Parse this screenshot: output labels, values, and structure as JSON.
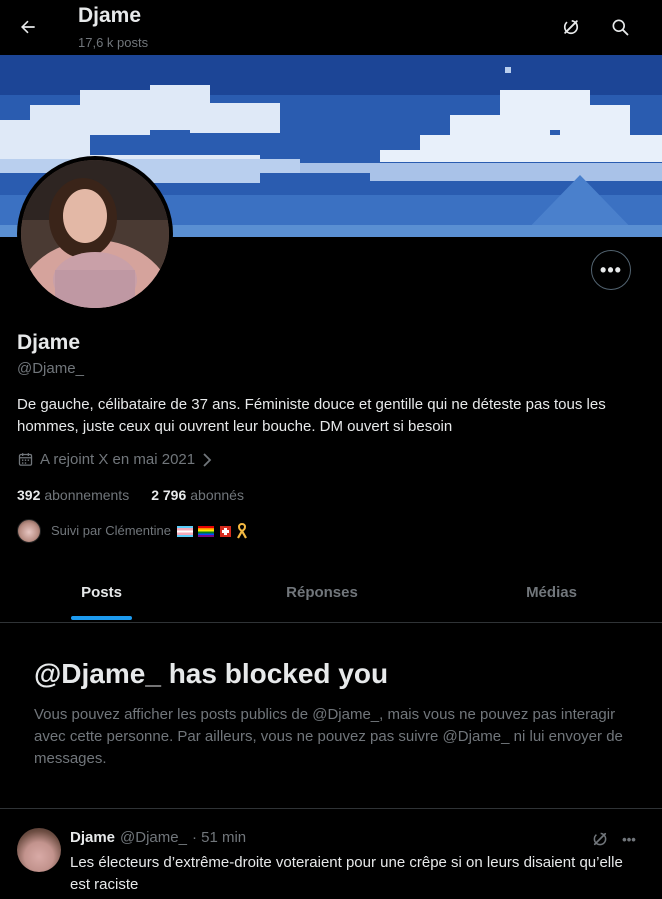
{
  "header": {
    "title": "Djame",
    "post_count": "17,6 k posts"
  },
  "profile": {
    "name": "Djame",
    "handle": "@Djame_",
    "bio": "De gauche, célibataire de 37 ans. Féministe douce et gentille qui ne déteste pas tous les hommes, juste ceux qui ouvrent leur bouche. DM ouvert si besoin",
    "joined": "A rejoint X en mai 2021",
    "following_count": "392",
    "following_label": "abonnements",
    "followers_count": "2 796",
    "followers_label": "abonnés",
    "followed_by": "Suivi par Clémentine",
    "more_label": "•••"
  },
  "tabs": [
    {
      "label": "Posts",
      "active": true
    },
    {
      "label": "Réponses",
      "active": false
    },
    {
      "label": "Médias",
      "active": false
    }
  ],
  "blocked": {
    "title": "@Djame_ has blocked you",
    "text": "Vous pouvez afficher les posts publics de @Djame_, mais vous ne pouvez pas interagir avec cette personne. Par ailleurs, vous ne pouvez pas suivre @Djame_ ni lui envoyer de messages."
  },
  "post": {
    "name": "Djame",
    "handle": "@Djame_",
    "time": "· 51 min",
    "text": "Les électeurs d’extrême-droite voteraient pour une crêpe si on leurs disaient qu’elle est raciste",
    "more_label": "•••"
  },
  "colors": {
    "accent": "#1d9bf0",
    "muted": "#71767b",
    "text": "#e7e9ea",
    "border": "#2f3336"
  }
}
